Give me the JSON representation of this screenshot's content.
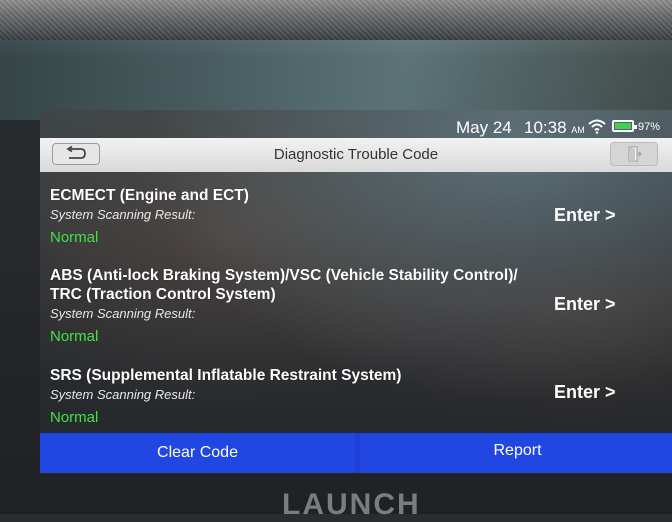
{
  "status_bar": {
    "date": "May 24",
    "time": "10:38",
    "ampm": "AM",
    "battery_percent": "97%",
    "icons": [
      "wifi-icon",
      "battery-icon"
    ]
  },
  "header": {
    "title": "Diagnostic Trouble Code",
    "back_icon": "return-arrow-icon",
    "exit_icon": "exit-door-icon"
  },
  "systems": [
    {
      "name_line1": "ECMECT (Engine and ECT)",
      "name_line2": "",
      "scan_label": "System Scanning Result:",
      "result": "Normal",
      "enter_label": "Enter >"
    },
    {
      "name_line1": "ABS (Anti-lock Braking System)/VSC (Vehicle Stability Control)/",
      "name_line2": "TRC (Traction Control System)",
      "scan_label": "System Scanning Result:",
      "result": "Normal",
      "enter_label": "Enter >"
    },
    {
      "name_line1": "SRS (Supplemental Inflatable Restraint System)",
      "name_line2": "",
      "scan_label": "System Scanning Result:",
      "result": "Normal",
      "enter_label": "Enter >"
    }
  ],
  "footer": {
    "clear_code_label": "Clear Code",
    "report_label": "Report"
  },
  "device_brand": "LAUNCH",
  "colors": {
    "accent_blue": "#2147e3",
    "normal_green": "#44e048",
    "battery_green": "#3fd34a"
  }
}
